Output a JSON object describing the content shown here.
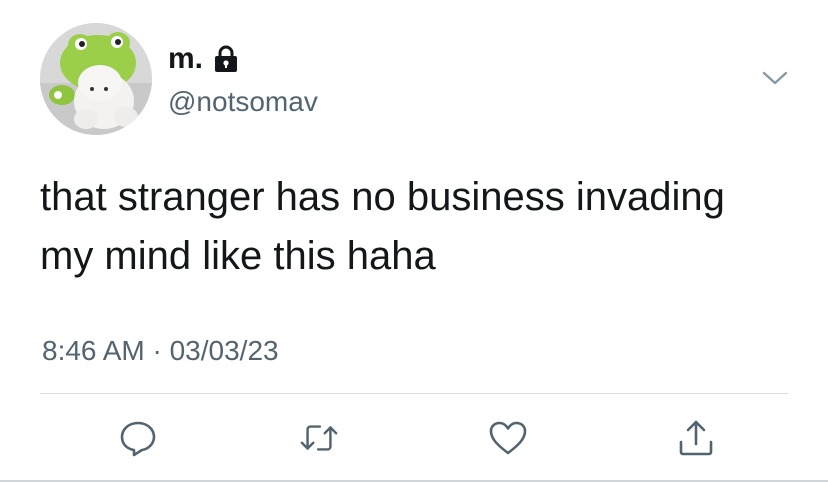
{
  "user": {
    "display_name": "m.",
    "handle": "@notsomav",
    "protected": true,
    "avatar_description": "avatar"
  },
  "tweet": {
    "text_lines": [
      "that stranger has no business invading",
      "my mind like this haha"
    ]
  },
  "meta": {
    "timestamp": "8:46 AM · 03/03/23"
  },
  "actions": {
    "reply_icon": "speech-bubble-icon",
    "retweet_icon": "retweet-icon",
    "like_icon": "heart-icon",
    "share_icon": "share-upload-icon"
  },
  "colors": {
    "text": "#14171a",
    "secondary": "#536471",
    "icon": "#536471",
    "divider": "#d9dee2"
  }
}
